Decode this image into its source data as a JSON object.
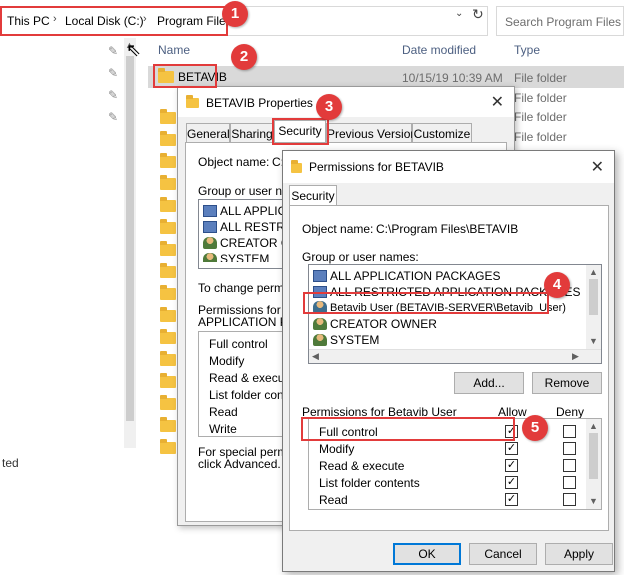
{
  "explorer": {
    "breadcrumb": [
      "This PC",
      "Local Disk (C:)",
      "Program Files"
    ],
    "search_placeholder": "Search Program Files",
    "columns": {
      "name": "Name",
      "date": "Date modified",
      "type": "Type"
    },
    "rows": [
      {
        "name": "BETAVIB",
        "date": "10/15/19 10:39 AM",
        "type": "File folder"
      },
      {
        "name": "",
        "date": "",
        "type": "File folder"
      },
      {
        "name": "",
        "date": "",
        "type": "File folder"
      },
      {
        "name": "",
        "date": "",
        "type": "File folder"
      }
    ],
    "status_text": "ted"
  },
  "properties": {
    "title": "BETAVIB Properties",
    "tabs": [
      "General",
      "Sharing",
      "Security",
      "Previous Versions",
      "Customize"
    ],
    "object_name_label": "Object name:",
    "object_name_value": "C:",
    "group_label": "Group or user name",
    "groups": [
      "ALL APPLICAT",
      "ALL RESTRICT",
      "CREATOR OW",
      "SYSTEM"
    ],
    "change_text": "To change permiss",
    "perm_label_1": "Permissions for ALL",
    "perm_label_2": "APPLICATION PAC",
    "permissions": [
      "Full control",
      "Modify",
      "Read & execute",
      "List folder conte",
      "Read",
      "Write"
    ],
    "special_1": "For special permiss",
    "special_2": "click Advanced."
  },
  "permissions_dialog": {
    "title": "Permissions for BETAVIB",
    "tab": "Security",
    "object_name_label": "Object name:",
    "object_name_value": "C:\\Program Files\\BETAVIB",
    "group_label": "Group or user names:",
    "groups": [
      "ALL APPLICATION PACKAGES",
      "ALL RESTRICTED APPLICATION PACKAGES",
      "Betavib User (BETAVIB-SERVER\\Betavib_User)",
      "CREATOR OWNER",
      "SYSTEM"
    ],
    "add_button": "Add...",
    "remove_button": "Remove",
    "perm_header": "Permissions for Betavib User",
    "allow_header": "Allow",
    "deny_header": "Deny",
    "permissions": [
      "Full control",
      "Modify",
      "Read & execute",
      "List folder contents",
      "Read"
    ],
    "allow_checked": [
      true,
      true,
      true,
      true,
      true
    ],
    "deny_checked": [
      false,
      false,
      false,
      false,
      false
    ],
    "ok_button": "OK",
    "cancel_button": "Cancel",
    "apply_button": "Apply"
  },
  "annotations": [
    "1",
    "2",
    "3",
    "4",
    "5"
  ],
  "colors": {
    "annotation": "#e23b3b",
    "folder": "#f5c342",
    "accent": "#0078d7"
  }
}
